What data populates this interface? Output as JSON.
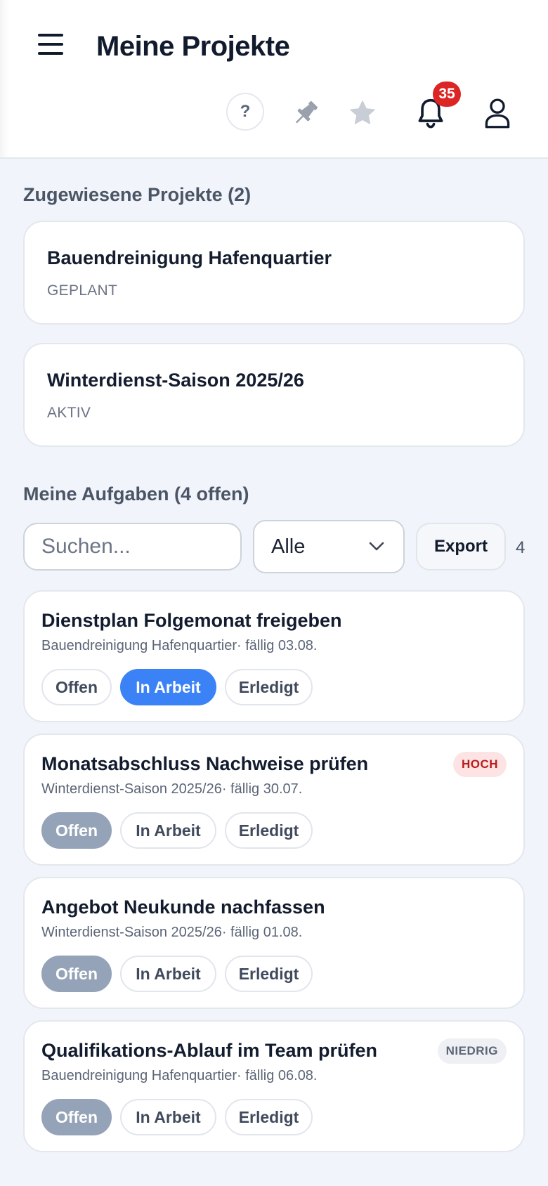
{
  "header": {
    "title": "Meine Projekte",
    "help_label": "?",
    "notification_count": "35",
    "icons": [
      "menu-icon",
      "help-icon",
      "pin-icon",
      "star-icon",
      "bell-icon",
      "user-icon"
    ]
  },
  "projects": {
    "title": "Zugewiesene Projekte (2)",
    "items": [
      {
        "name": "Bauendreinigung Hafenquartier",
        "status": "GEPLANT"
      },
      {
        "name": "Winterdienst-Saison 2025/26",
        "status": "AKTIV"
      }
    ]
  },
  "tasks": {
    "title": "Meine Aufgaben (4 offen)",
    "search_placeholder": "Suchen...",
    "filter_value": "Alle",
    "export_label": "Export",
    "count": "4",
    "status_labels": {
      "open": "Offen",
      "in_progress": "In Arbeit",
      "done": "Erledigt"
    },
    "items": [
      {
        "title": "Dienstplan Folgemonat freigeben",
        "meta": "Bauendreinigung Hafenquartier· fällig 03.08.",
        "priority": "",
        "status": "In Arbeit"
      },
      {
        "title": "Monatsabschluss Nachweise prüfen",
        "meta": "Winterdienst-Saison 2025/26· fällig 30.07.",
        "priority": "HOCH",
        "status": "Offen"
      },
      {
        "title": "Angebot Neukunde nachfassen",
        "meta": "Winterdienst-Saison 2025/26· fällig 01.08.",
        "priority": "",
        "status": "Offen"
      },
      {
        "title": "Qualifikations-Ablauf im Team prüfen",
        "meta": "Bauendreinigung Hafenquartier· fällig 06.08.",
        "priority": "NIEDRIG",
        "status": "Offen"
      }
    ]
  },
  "colors": {
    "accent": "#3b82f6",
    "badge": "#dc2626",
    "open_active": "#95a3b8",
    "priority_high_bg": "#fde3e3",
    "priority_high_text": "#b91c1c",
    "priority_low_bg": "#eef0f3"
  }
}
